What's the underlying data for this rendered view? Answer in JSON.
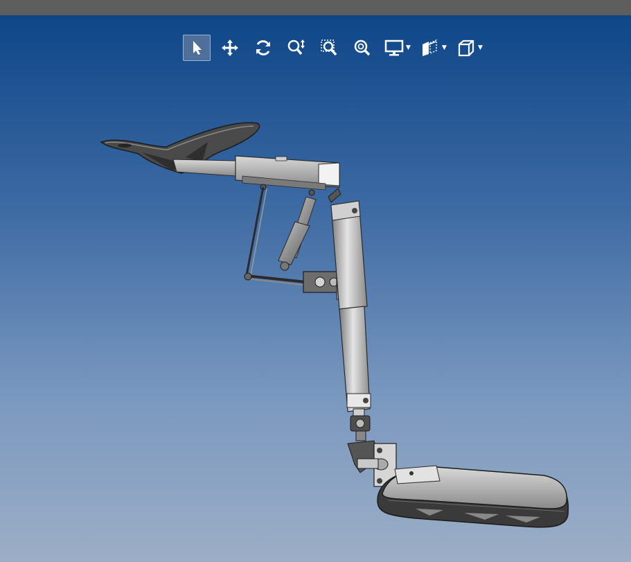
{
  "toolbar": {
    "buttons": [
      {
        "icon": "select-arrow-icon",
        "active": true,
        "dropdown": false
      },
      {
        "icon": "pan-move-icon",
        "active": false,
        "dropdown": false
      },
      {
        "icon": "rotate-icon",
        "active": false,
        "dropdown": false
      },
      {
        "icon": "zoom-in-out-icon",
        "active": false,
        "dropdown": false
      },
      {
        "icon": "zoom-window-icon",
        "active": false,
        "dropdown": false
      },
      {
        "icon": "zoom-fit-icon",
        "active": false,
        "dropdown": false
      },
      {
        "icon": "display-monitor-icon",
        "active": false,
        "dropdown": true
      },
      {
        "icon": "section-view-icon",
        "active": false,
        "dropdown": true
      },
      {
        "icon": "view-cube-icon",
        "active": false,
        "dropdown": true
      }
    ]
  },
  "colors": {
    "topbar": "#5e5e5e",
    "viewport_top": "#0e4688",
    "viewport_bottom": "#9caec6",
    "active_button": "#4d6f9a",
    "icon": "#ffffff",
    "model_metal": "#b8b8b8"
  }
}
